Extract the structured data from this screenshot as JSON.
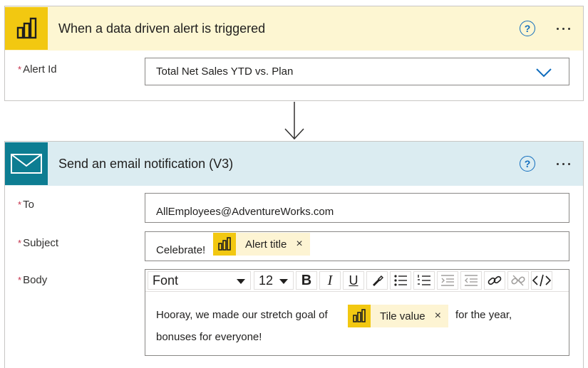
{
  "trigger": {
    "title": "When a data driven alert is triggered",
    "icon": "power-bi-icon",
    "header_bg": "#fdf6d2",
    "icon_bg": "#f2c811",
    "help_label": "?",
    "fields": {
      "alert_id": {
        "label": "Alert Id",
        "required_mark": "*",
        "value": "Total Net Sales YTD vs. Plan"
      }
    }
  },
  "action": {
    "title": "Send an email notification (V3)",
    "icon": "mail-icon",
    "header_bg": "#dbecf1",
    "icon_bg": "#0d7d92",
    "help_label": "?",
    "fields": {
      "to": {
        "label": "To",
        "required_mark": "*",
        "value": "AllEmployees@AdventureWorks.com"
      },
      "subject": {
        "label": "Subject",
        "required_mark": "*",
        "prefix": "Celebrate!",
        "token": "Alert title"
      },
      "body": {
        "label": "Body",
        "required_mark": "*",
        "toolbar": {
          "font": "Font",
          "size": "12",
          "bold": "B",
          "italic": "I",
          "underline": "U"
        },
        "text_before": "Hooray, we made our stretch goal of",
        "token": "Tile value",
        "text_after": "for the year,",
        "text_line2": "bonuses for everyone!"
      }
    }
  },
  "token_remove": "×",
  "colors": {
    "accent_blue": "#0f6cbd",
    "required_red": "#c4314b",
    "token_bg": "#fdf4d3",
    "powerbi_yellow": "#f2c811"
  }
}
